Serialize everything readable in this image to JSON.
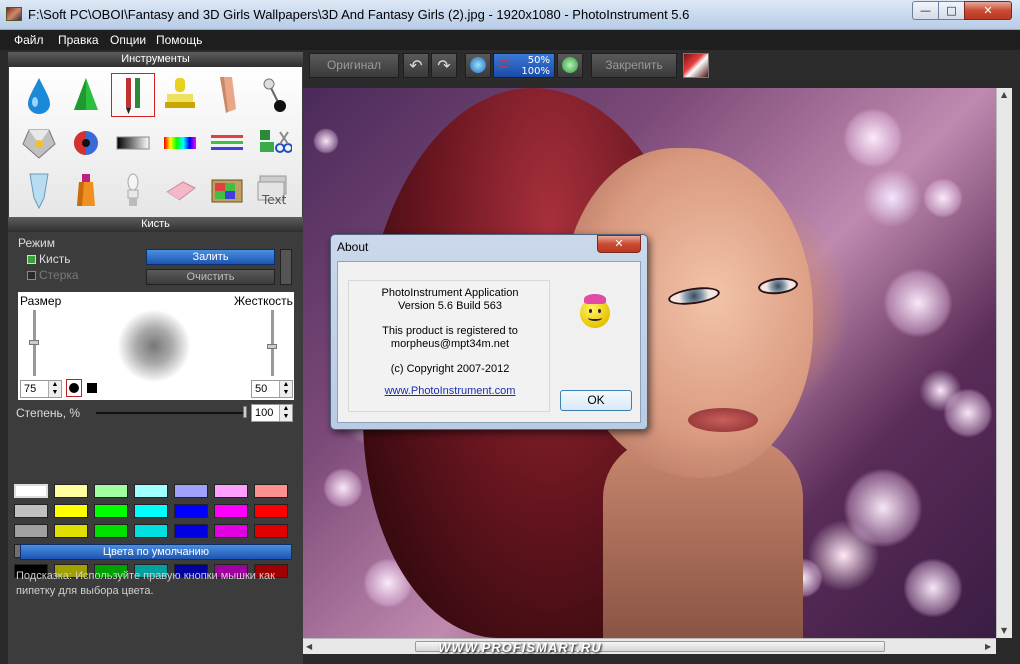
{
  "window": {
    "title": "F:\\Soft PC\\OBOI\\Fantasy and 3D Girls Wallpapers\\3D And Fantasy Girls (2).jpg - 1920x1080 - PhotoInstrument 5.6",
    "min_glyph": "—",
    "max_glyph": "□",
    "close_glyph": "✕"
  },
  "menu": [
    "Файл",
    "Правка",
    "Опции",
    "Помощь"
  ],
  "tools_panel": {
    "title": "Инструменты",
    "tools": [
      "drop-tool",
      "cone-tool",
      "brush-tool",
      "stamp-tool",
      "finger-tool",
      "pin-tool",
      "gem-tool",
      "eye-tool",
      "gradient-tool",
      "rainbow-tool",
      "lines-tool",
      "scissors-tool",
      "tube-tool",
      "bottle-tool",
      "bulb-tool",
      "eraser-tool",
      "tv-tool",
      "text-tool"
    ],
    "text_tool_label": "Text"
  },
  "brush_panel": {
    "title": "Кисть",
    "mode_label": "Режим",
    "brush_label": "Кисть",
    "eraser_label": "Стерка",
    "fill_button": "Залить",
    "clear_button": "Очистить",
    "size_label": "Размер",
    "hardness_label": "Жесткость",
    "size_value": "75",
    "hardness_value": "50",
    "degree_label": "Степень, %",
    "degree_value": "100",
    "defaults_button": "Цвета по умолчанию",
    "hint_line1": "Подсказка: Используйте правую кнопки мышки как",
    "hint_line2": "пипетку для выбора цвета."
  },
  "palette": [
    [
      "#ffffff",
      "#ffffa0",
      "#a0ffa0",
      "#a0ffff",
      "#a0a0ff",
      "#ffa0ff",
      "#ff9090"
    ],
    [
      "#c0c0c0",
      "#ffff00",
      "#00ff00",
      "#00ffff",
      "#0000ff",
      "#ff00ff",
      "#ff0000"
    ],
    [
      "#a0a0a0",
      "#e0e000",
      "#00e000",
      "#00e0e0",
      "#0000e0",
      "#e000e0",
      "#e00000"
    ],
    [
      "#707070",
      "#c0c000",
      "#00c000",
      "#00c0c0",
      "#0000c0",
      "#c000c0",
      "#c00000"
    ],
    [
      "#000000",
      "#a0a000",
      "#00a000",
      "#00a0a0",
      "#0000a0",
      "#a000a0",
      "#a00000"
    ]
  ],
  "toolbar": {
    "original_button": "Оригинал",
    "zoom_top": "50%",
    "zoom_bottom": "100%",
    "pin_button": "Закрепить"
  },
  "dialog": {
    "title": "About",
    "close_glyph": "✕",
    "line1": "PhotoInstrument Application",
    "line2": "Version 5.6 Build 563",
    "line3": "This product is registered to",
    "line4": "morpheus@mpt34m.net",
    "line5": "(c) Copyright 2007-2012",
    "link": "www.PhotoInstrument.com",
    "ok_button": "OK"
  },
  "watermark": "WWW.PROFISMART.RU"
}
